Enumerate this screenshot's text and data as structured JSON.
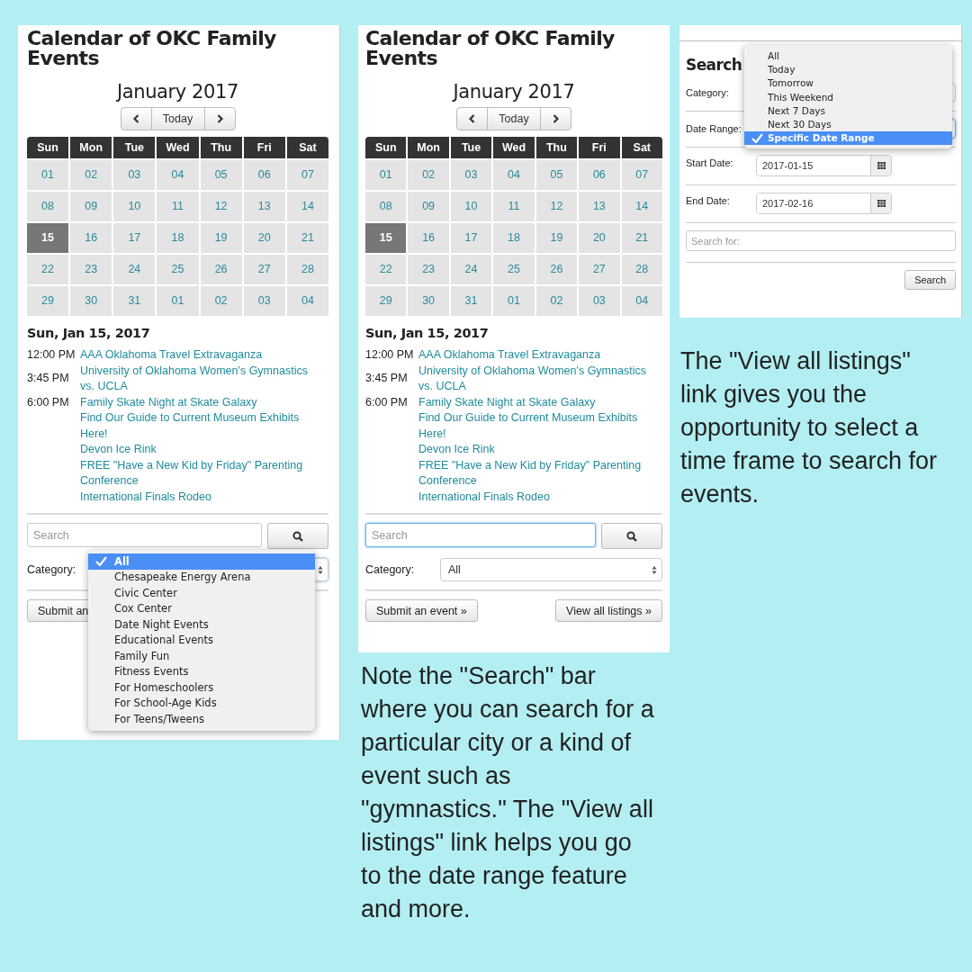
{
  "views": [
    {
      "title": "Calendar of OKC Family Events",
      "month": "January 2017",
      "today_button": "Today",
      "weekdays": [
        "Sun",
        "Mon",
        "Tue",
        "Wed",
        "Thu",
        "Fri",
        "Sat"
      ],
      "days": [
        {
          "label": "01",
          "selected": false
        },
        {
          "label": "02",
          "selected": false
        },
        {
          "label": "03",
          "selected": false
        },
        {
          "label": "04",
          "selected": false
        },
        {
          "label": "05",
          "selected": false
        },
        {
          "label": "06",
          "selected": false
        },
        {
          "label": "07",
          "selected": false
        },
        {
          "label": "08",
          "selected": false
        },
        {
          "label": "09",
          "selected": false
        },
        {
          "label": "10",
          "selected": false
        },
        {
          "label": "11",
          "selected": false
        },
        {
          "label": "12",
          "selected": false
        },
        {
          "label": "13",
          "selected": false
        },
        {
          "label": "14",
          "selected": false
        },
        {
          "label": "15",
          "selected": true
        },
        {
          "label": "16",
          "selected": false
        },
        {
          "label": "17",
          "selected": false
        },
        {
          "label": "18",
          "selected": false
        },
        {
          "label": "19",
          "selected": false
        },
        {
          "label": "20",
          "selected": false
        },
        {
          "label": "21",
          "selected": false
        },
        {
          "label": "22",
          "selected": false
        },
        {
          "label": "23",
          "selected": false
        },
        {
          "label": "24",
          "selected": false
        },
        {
          "label": "25",
          "selected": false
        },
        {
          "label": "26",
          "selected": false
        },
        {
          "label": "27",
          "selected": false
        },
        {
          "label": "28",
          "selected": false
        },
        {
          "label": "29",
          "selected": false
        },
        {
          "label": "30",
          "selected": false
        },
        {
          "label": "31",
          "selected": false
        },
        {
          "label": "01",
          "selected": false
        },
        {
          "label": "02",
          "selected": false
        },
        {
          "label": "03",
          "selected": false
        },
        {
          "label": "04",
          "selected": false
        }
      ],
      "date_heading": "Sun, Jan 15, 2017",
      "events": [
        {
          "time": "12:00 PM",
          "title": "AAA Oklahoma Travel Extravaganza"
        },
        {
          "time": "3:45 PM",
          "title": "University of Oklahoma Women's Gymnastics vs. UCLA"
        },
        {
          "time": "6:00 PM",
          "title": "Family Skate Night at Skate Galaxy"
        },
        {
          "title": "Find Our Guide to Current Museum Exhibits Here!"
        },
        {
          "title": "Devon Ice Rink"
        },
        {
          "title": "FREE \"Have a New Kid by Friday\" Parenting Conference"
        },
        {
          "title": "International Finals Rodeo"
        }
      ],
      "search": {
        "placeholder": "Search",
        "focused": false
      },
      "category": {
        "label": "Category:",
        "focused": true
      },
      "buttons": [
        "Submit an"
      ],
      "dropdown": [
        {
          "label": "All",
          "selected": true
        },
        {
          "label": "Chesapeake Energy Arena",
          "selected": false
        },
        {
          "label": "Civic Center",
          "selected": false
        },
        {
          "label": "Cox Center",
          "selected": false
        },
        {
          "label": "Date Night Events",
          "selected": false
        },
        {
          "label": "Educational Events",
          "selected": false
        },
        {
          "label": "Family Fun",
          "selected": false
        },
        {
          "label": "Fitness Events",
          "selected": false
        },
        {
          "label": "For Homeschoolers",
          "selected": false
        },
        {
          "label": "For School-Age Kids",
          "selected": false
        },
        {
          "label": "For Teens/Tweens",
          "selected": false
        }
      ]
    },
    {
      "title": "Calendar of OKC Family Events",
      "month": "January 2017",
      "today_button": "Today",
      "weekdays": [
        "Sun",
        "Mon",
        "Tue",
        "Wed",
        "Thu",
        "Fri",
        "Sat"
      ],
      "days": [
        {
          "label": "01",
          "selected": false
        },
        {
          "label": "02",
          "selected": false
        },
        {
          "label": "03",
          "selected": false
        },
        {
          "label": "04",
          "selected": false
        },
        {
          "label": "05",
          "selected": false
        },
        {
          "label": "06",
          "selected": false
        },
        {
          "label": "07",
          "selected": false
        },
        {
          "label": "08",
          "selected": false
        },
        {
          "label": "09",
          "selected": false
        },
        {
          "label": "10",
          "selected": false
        },
        {
          "label": "11",
          "selected": false
        },
        {
          "label": "12",
          "selected": false
        },
        {
          "label": "13",
          "selected": false
        },
        {
          "label": "14",
          "selected": false
        },
        {
          "label": "15",
          "selected": true
        },
        {
          "label": "16",
          "selected": false
        },
        {
          "label": "17",
          "selected": false
        },
        {
          "label": "18",
          "selected": false
        },
        {
          "label": "19",
          "selected": false
        },
        {
          "label": "20",
          "selected": false
        },
        {
          "label": "21",
          "selected": false
        },
        {
          "label": "22",
          "selected": false
        },
        {
          "label": "23",
          "selected": false
        },
        {
          "label": "24",
          "selected": false
        },
        {
          "label": "25",
          "selected": false
        },
        {
          "label": "26",
          "selected": false
        },
        {
          "label": "27",
          "selected": false
        },
        {
          "label": "28",
          "selected": false
        },
        {
          "label": "29",
          "selected": false
        },
        {
          "label": "30",
          "selected": false
        },
        {
          "label": "31",
          "selected": false
        },
        {
          "label": "01",
          "selected": false
        },
        {
          "label": "02",
          "selected": false
        },
        {
          "label": "03",
          "selected": false
        },
        {
          "label": "04",
          "selected": false
        }
      ],
      "date_heading": "Sun, Jan 15, 2017",
      "events": [
        {
          "time": "12:00 PM",
          "title": "AAA Oklahoma Travel Extravaganza"
        },
        {
          "time": "3:45 PM",
          "title": "University of Oklahoma Women's Gymnastics vs. UCLA"
        },
        {
          "time": "6:00 PM",
          "title": "Family Skate Night at Skate Galaxy"
        },
        {
          "title": "Find Our Guide to Current Museum Exhibits Here!"
        },
        {
          "title": "Devon Ice Rink"
        },
        {
          "title": "FREE \"Have a New Kid by Friday\" Parenting Conference"
        },
        {
          "title": "International Finals Rodeo"
        }
      ],
      "search": {
        "placeholder": "Search",
        "focused": true
      },
      "category": {
        "label": "Category:",
        "value": "All",
        "focused": false
      },
      "buttons": [
        "Submit an event »",
        "View all listings »"
      ]
    }
  ],
  "search_form": {
    "heading": "Search",
    "category_label": "Category:",
    "date_range": {
      "label": "Date Range:",
      "focused": true
    },
    "start_date": {
      "label": "Start Date:",
      "value": "2017-01-15"
    },
    "end_date": {
      "label": "End Date:",
      "value": "2017-02-16"
    },
    "search_for": {
      "placeholder": "Search for:"
    },
    "search_button": "Search",
    "dropdown": [
      {
        "label": "All",
        "selected": false
      },
      {
        "label": "Today",
        "selected": false
      },
      {
        "label": "Tomorrow",
        "selected": false
      },
      {
        "label": "This Weekend",
        "selected": false
      },
      {
        "label": "Next 7 Days",
        "selected": false
      },
      {
        "label": "Next 30 Days",
        "selected": false
      },
      {
        "label": "Specific Date Range",
        "selected": true
      }
    ]
  },
  "captions": [
    "Note the \"Search\" bar where you can search for a particular city or a kind of event such as \"gymnastics.\" The \"View all listings\" link helps you go to the date range feature and more.",
    "The \"View all listings\" link gives you the opportunity to select a time frame to search for events."
  ]
}
